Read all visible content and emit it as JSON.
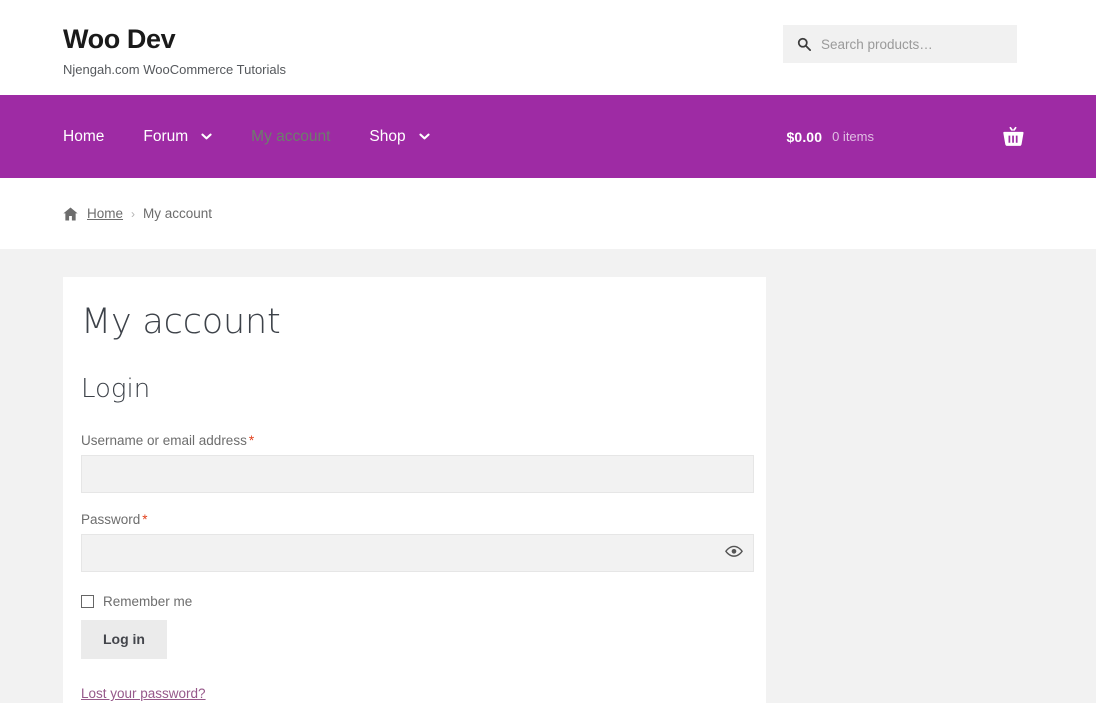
{
  "header": {
    "site_title": "Woo Dev",
    "tagline": "Njengah.com WooCommerce Tutorials",
    "search": {
      "icon": "search-icon",
      "placeholder": "Search products…",
      "value": ""
    }
  },
  "nav": {
    "background_color": "#9e2ba4",
    "items": [
      {
        "label": "Home",
        "has_dropdown": false,
        "current": false
      },
      {
        "label": "Forum",
        "has_dropdown": true,
        "current": false
      },
      {
        "label": "My account",
        "has_dropdown": false,
        "current": true
      },
      {
        "label": "Shop",
        "has_dropdown": true,
        "current": false
      }
    ],
    "cart": {
      "amount": "$0.00",
      "items": "0 items",
      "icon": "shopping-basket-icon"
    }
  },
  "breadcrumb": {
    "home_icon": "home-icon",
    "items": [
      {
        "label": "Home",
        "link": true
      },
      {
        "label": "My account",
        "link": false
      }
    ],
    "separator": "›"
  },
  "main": {
    "page_title": "My account",
    "login_heading": "Login",
    "form": {
      "username": {
        "label": "Username or email address",
        "required_marker": "*",
        "value": "",
        "placeholder": ""
      },
      "password": {
        "label": "Password",
        "required_marker": "*",
        "value": "",
        "placeholder": "",
        "toggle_icon": "eye-icon"
      },
      "remember_me": {
        "label": "Remember me",
        "checked": false
      },
      "submit_label": "Log in",
      "lost_password_label": "Lost your password?"
    }
  },
  "colors": {
    "brand_purple": "#9e2ba4",
    "link_purple": "#96588a",
    "required_red": "#e2401c",
    "page_background": "#f2f2f2",
    "card_background": "#ffffff",
    "current_nav_item": "#6d7d6c"
  }
}
